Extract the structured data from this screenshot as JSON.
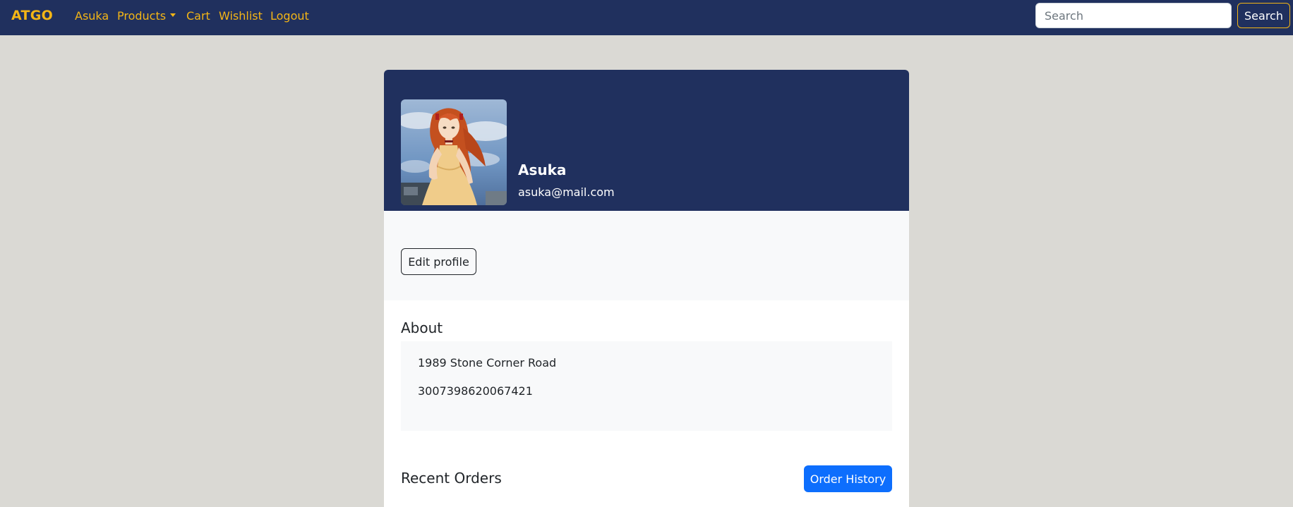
{
  "navbar": {
    "brand": "ATGO",
    "links": [
      "Asuka",
      "Products",
      "Cart",
      "Wishlist",
      "Logout"
    ],
    "search": {
      "placeholder": "Search",
      "value": "",
      "button_label": "Search"
    }
  },
  "profile": {
    "name": "Asuka",
    "email": "asuka@mail.com",
    "edit_label": "Edit profile"
  },
  "about": {
    "heading": "About",
    "lines": [
      "1989 Stone Corner Road",
      "3007398620067421"
    ]
  },
  "orders": {
    "heading": "Recent Orders",
    "history_label": "Order History"
  },
  "colors": {
    "navbar_bg": "#20305e",
    "accent": "#f3b516",
    "page_bg": "#dad9d4",
    "primary_button": "#0d6efd",
    "light_panel": "#f8f9fa"
  },
  "icons": {
    "dropdown": "caret-down-icon",
    "avatar": "user-avatar-image"
  }
}
